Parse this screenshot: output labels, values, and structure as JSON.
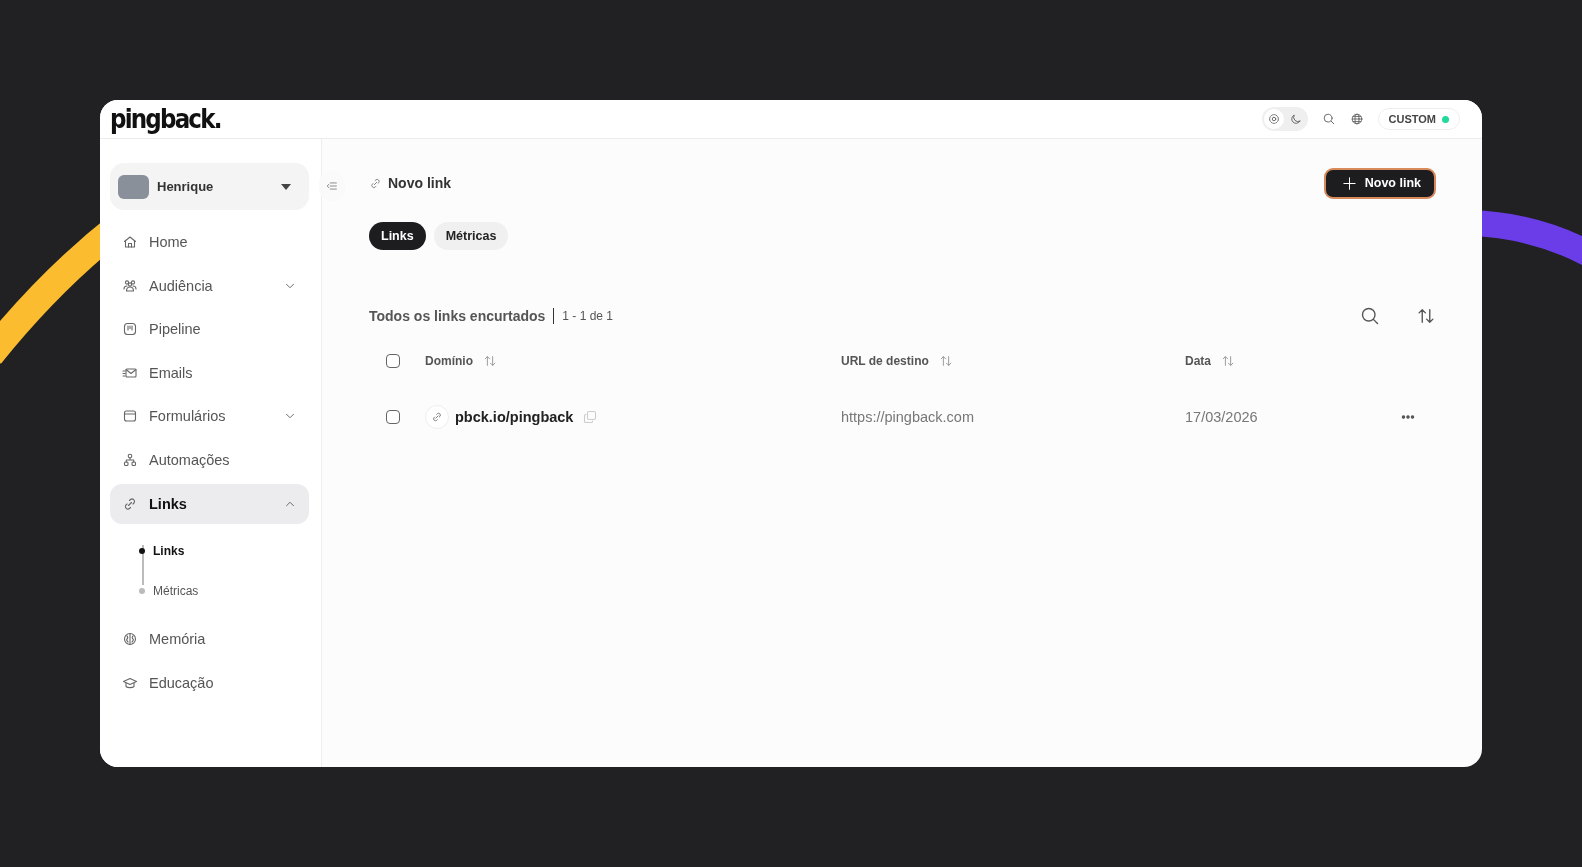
{
  "header": {
    "logo": "pingback.",
    "theme_toggle": [
      {
        "kind": "light",
        "selected": true
      },
      {
        "kind": "dark",
        "selected": false
      }
    ],
    "badge": "CUSTOM"
  },
  "sidebar": {
    "account": {
      "name": "Henrique"
    },
    "items": [
      {
        "label": "Home",
        "selected": false
      },
      {
        "label": "Audiência",
        "selected": false,
        "expanded": false
      },
      {
        "label": "Pipeline",
        "selected": false
      },
      {
        "label": "Emails",
        "selected": false
      },
      {
        "label": "Formulários",
        "selected": false,
        "expanded": false
      },
      {
        "label": "Automações",
        "selected": false
      },
      {
        "label": "Links",
        "selected": true,
        "expanded": true,
        "children": [
          {
            "label": "Links",
            "selected": true
          },
          {
            "label": "Métricas",
            "selected": false
          }
        ]
      },
      {
        "label": "Memória",
        "selected": false
      },
      {
        "label": "Educação",
        "selected": false
      }
    ]
  },
  "page": {
    "title": "Novo link",
    "new_button": "Novo link",
    "tabs": [
      {
        "label": "Links",
        "selected": true
      },
      {
        "label": "Métricas",
        "selected": false
      }
    ],
    "list_title": "Todos os links encurtados",
    "count": "1 - 1 de 1",
    "table": {
      "select_all_checked": false,
      "columns": [
        "Domínio",
        "URL de destino",
        "Data"
      ],
      "rows": [
        {
          "checked": false,
          "domain": "pbck.io/pingback",
          "url": "https://pingback.com",
          "date": "17/03/2026"
        }
      ]
    }
  }
}
